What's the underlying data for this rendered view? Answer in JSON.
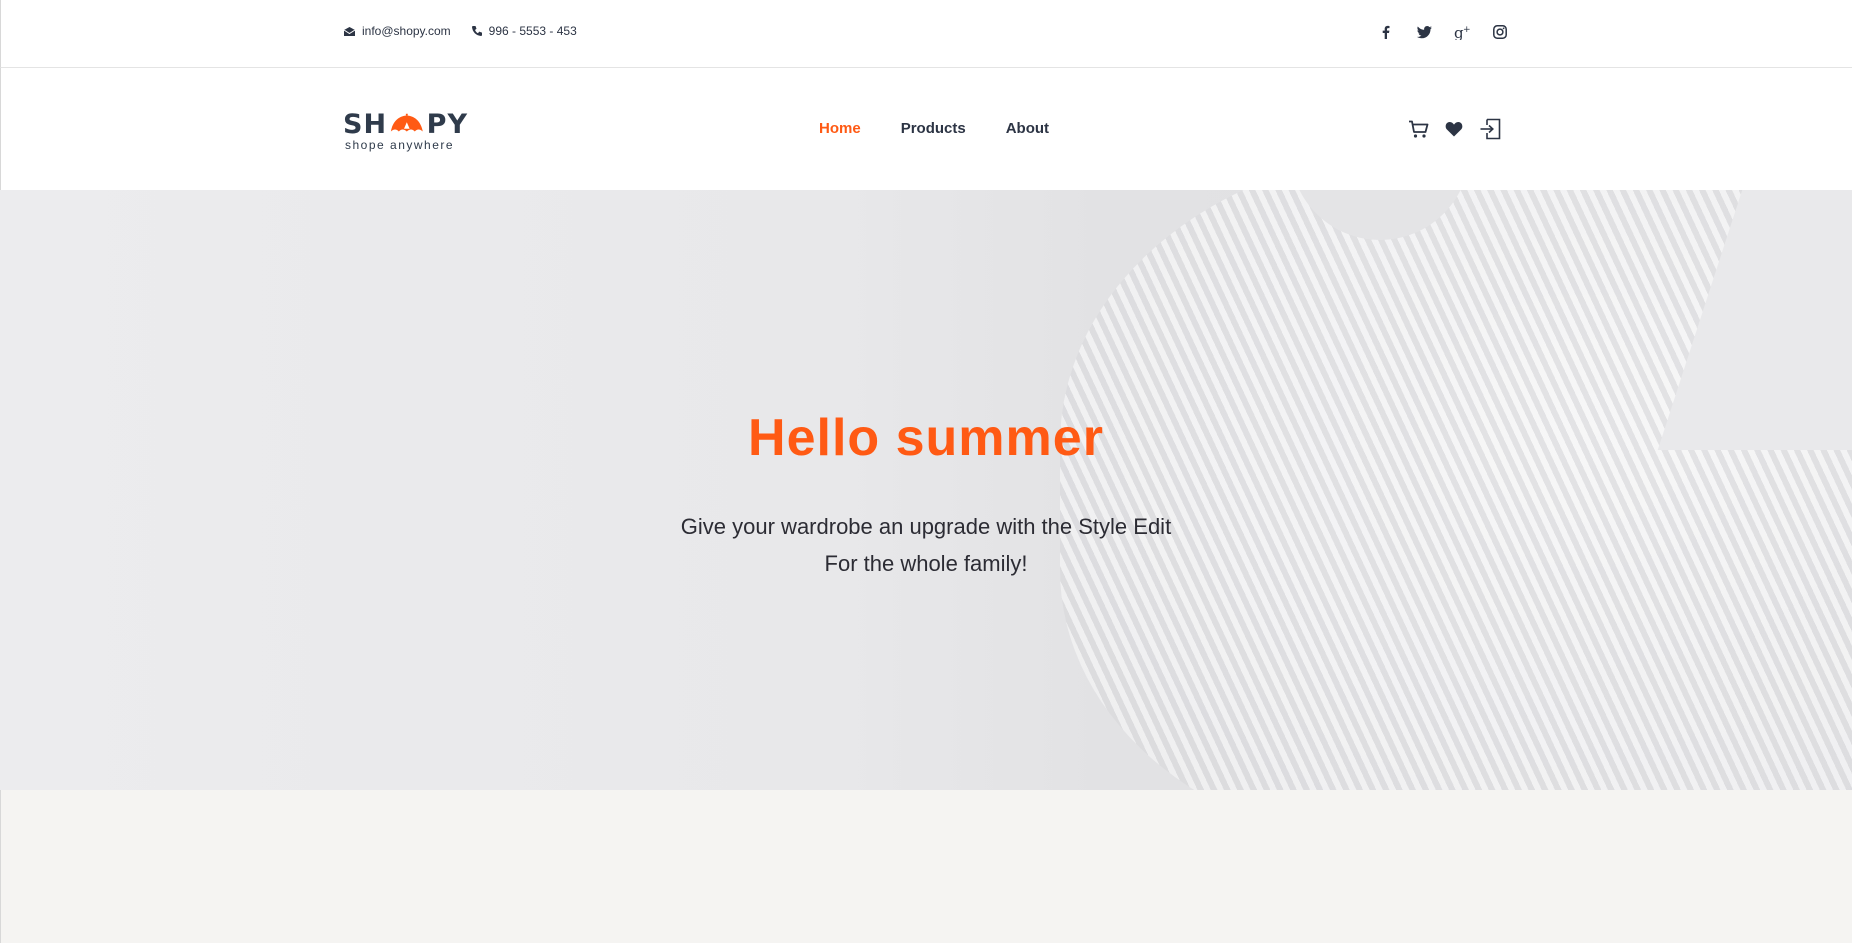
{
  "topbar": {
    "email": "info@shopy.com",
    "phone": "996 - 5553 - 453",
    "social": [
      "facebook-icon",
      "twitter-icon",
      "google-plus-icon",
      "instagram-icon"
    ]
  },
  "brand": {
    "name_left": "SH",
    "name_right": "PY",
    "tagline": "shope anywhere",
    "accent_color": "#ff5a14",
    "text_color": "#2f3b4b"
  },
  "nav": {
    "items": [
      {
        "label": "Home",
        "active": true
      },
      {
        "label": "Products",
        "active": false
      },
      {
        "label": "About",
        "active": false
      }
    ],
    "actions": [
      "cart-icon",
      "heart-icon",
      "login-icon"
    ]
  },
  "hero": {
    "title": "Hello summer",
    "line1": "Give your wardrobe an upgrade with the Style Edit",
    "line2": "For the whole family!"
  }
}
